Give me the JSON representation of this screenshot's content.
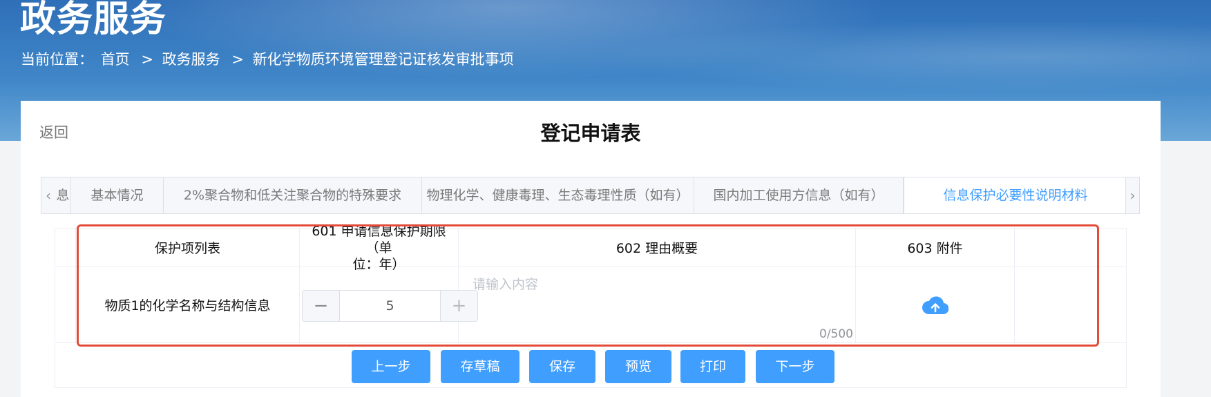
{
  "banner": {
    "title": "政务服务",
    "crumb_prefix": "当前位置：",
    "crumbs": [
      "首页",
      "政务服务",
      "新化学物质环境管理登记证核发审批事项"
    ],
    "crumb_sep": ">"
  },
  "header": {
    "back": "返回",
    "title": "登记申请表"
  },
  "tabs": {
    "items": [
      {
        "label": "息"
      },
      {
        "label": "基本情况"
      },
      {
        "label": "2%聚合物和低关注聚合物的特殊要求"
      },
      {
        "label": "物理化学、健康毒理、生态毒理性质（如有）"
      },
      {
        "label": "国内加工使用方信息（如有）"
      },
      {
        "label": "信息保护必要性说明材料",
        "active": true
      }
    ],
    "arrow_left": "‹",
    "arrow_right": "›"
  },
  "table": {
    "headers": {
      "list": "保护项列表",
      "period_line1": "601 申请信息保护期限（单",
      "period_line2": "位：年）",
      "reason": "602 理由概要",
      "attachment": "603 附件"
    },
    "row": {
      "item": "物质1的化学名称与结构信息",
      "period_value": "5",
      "stepper_minus": "−",
      "stepper_plus": "+",
      "reason_placeholder": "请输入内容",
      "reason_value": "",
      "char_count": "0/500",
      "upload_icon": "cloud-upload-icon"
    }
  },
  "actions": {
    "prev": "上一步",
    "draft": "存草稿",
    "save": "保存",
    "preview": "预览",
    "print": "打印",
    "next": "下一步"
  },
  "colors": {
    "primary": "#409eff",
    "highlight": "#e34b38",
    "banner": "#3f86c8"
  }
}
